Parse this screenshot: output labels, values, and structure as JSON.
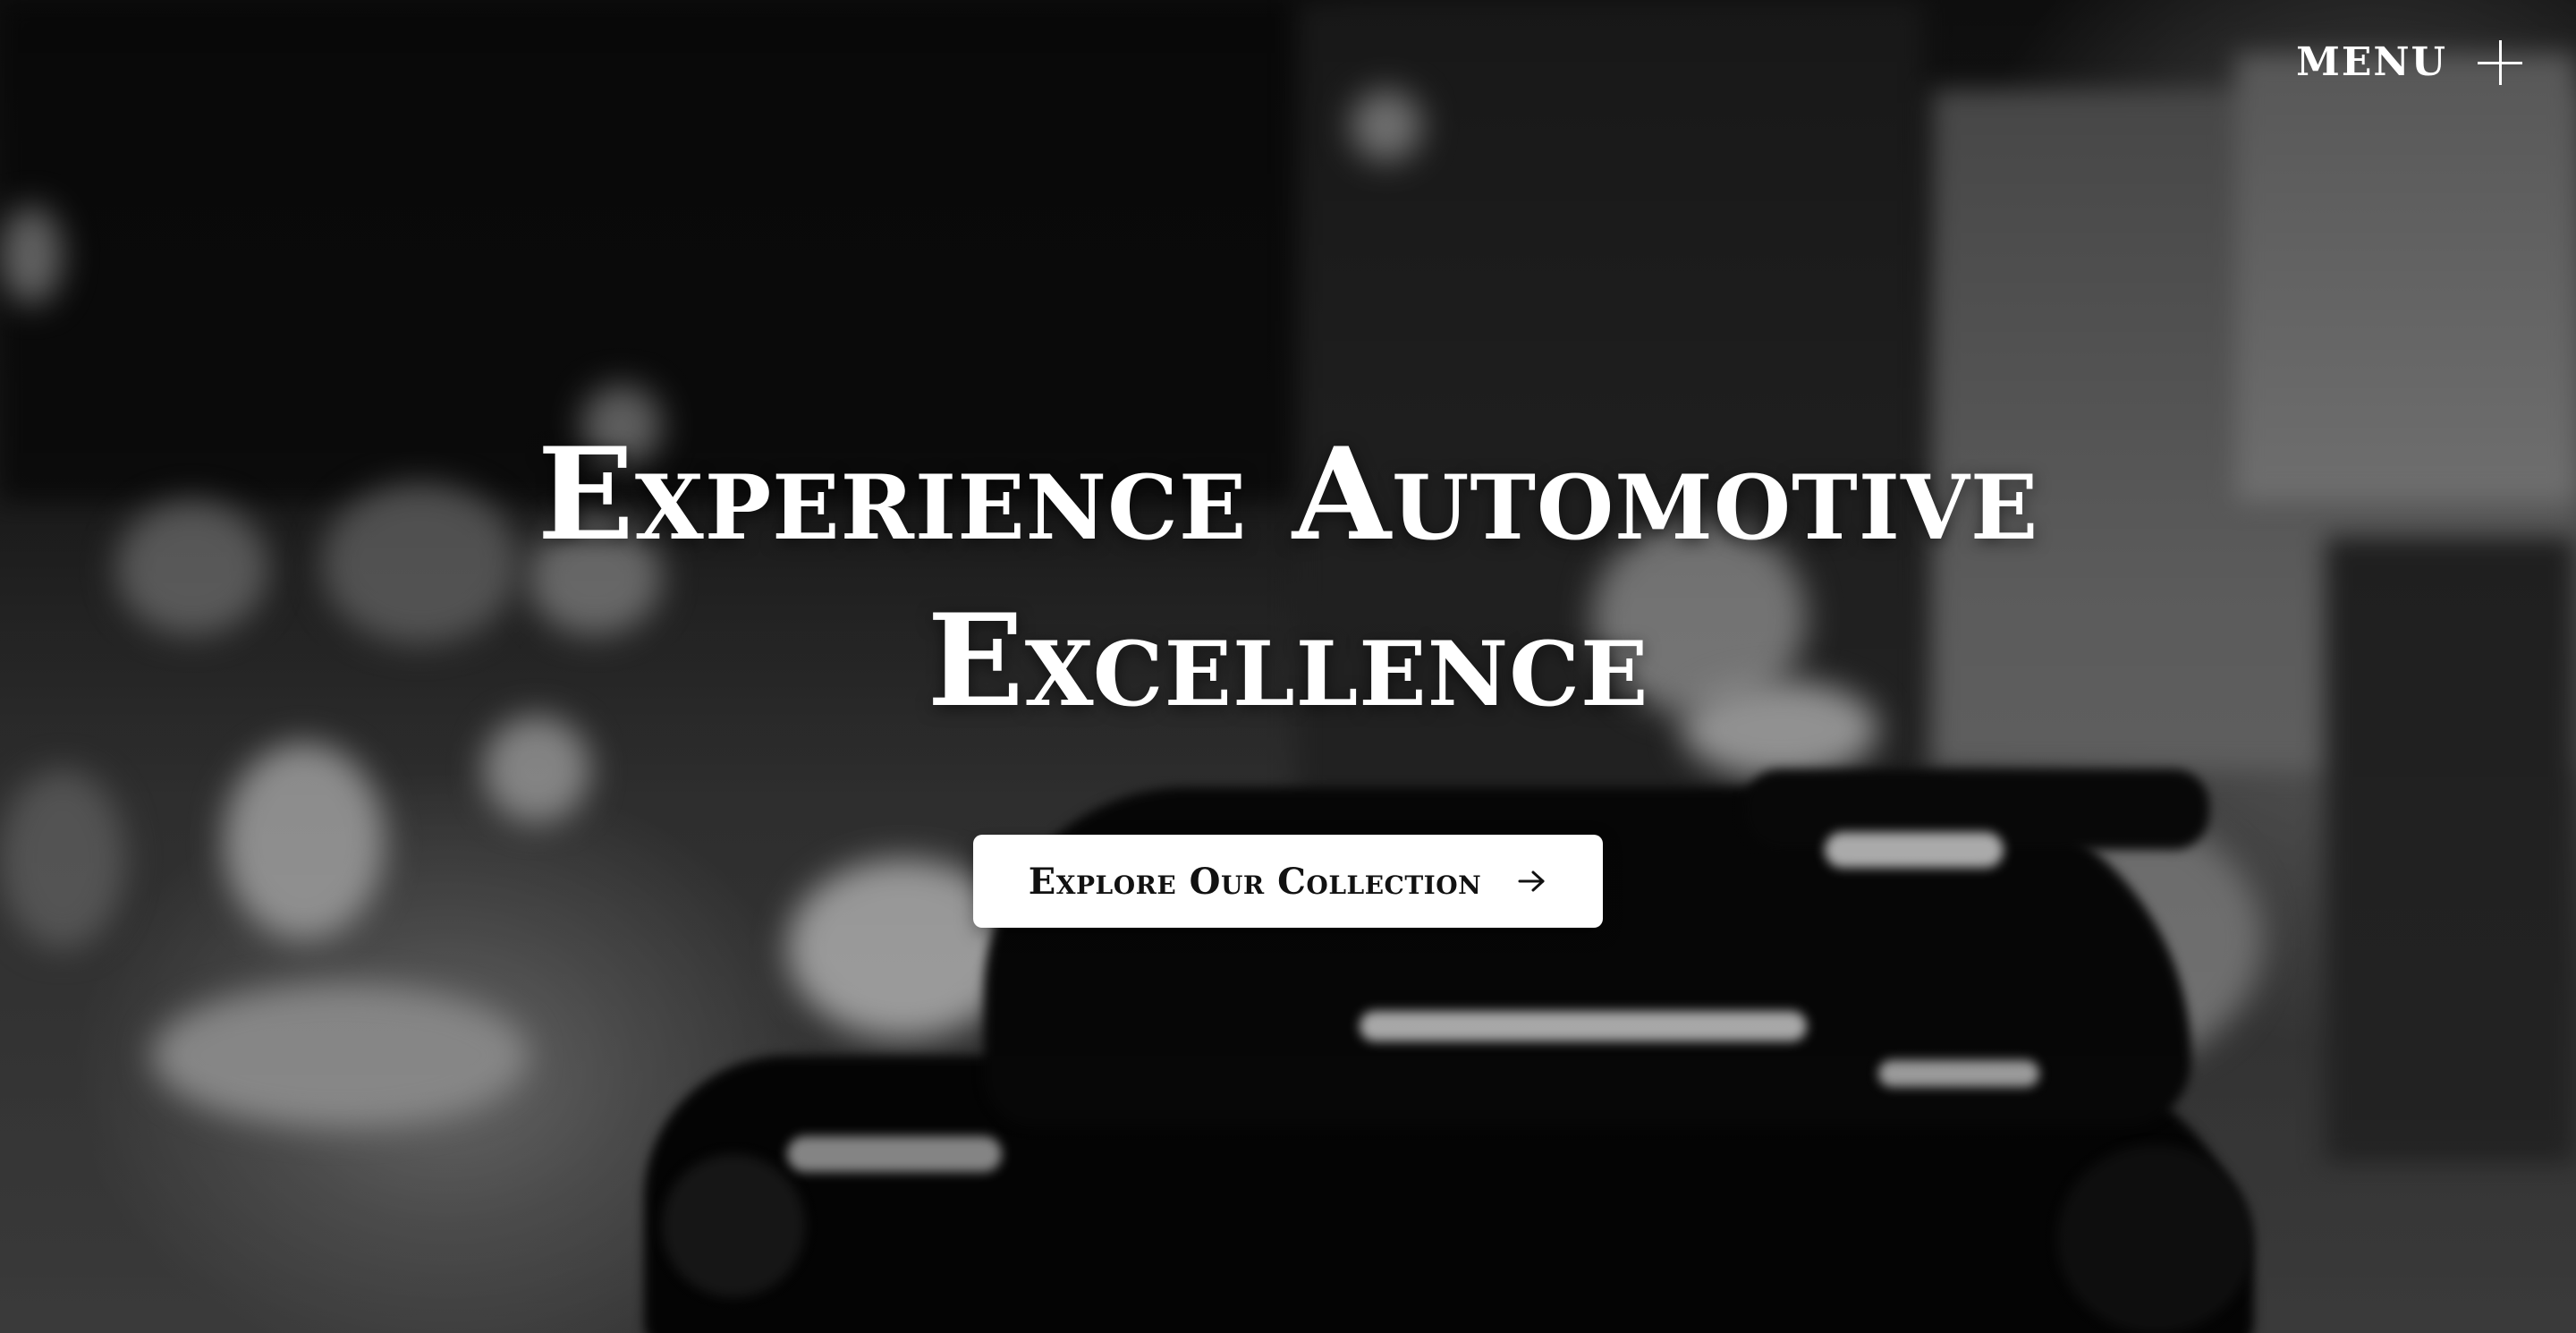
{
  "header": {
    "menu_label": "MENU",
    "menu_icon": "plus-icon"
  },
  "hero": {
    "headline_line1": "Experience Automotive",
    "headline_line2": "Excellence",
    "cta_label": "Explore Our Collection",
    "cta_icon": "arrow-right-icon",
    "background": "blurred grayscale night street with sports car"
  },
  "colors": {
    "text": "#ffffff",
    "button_bg": "#ffffff",
    "button_text": "#111111"
  }
}
